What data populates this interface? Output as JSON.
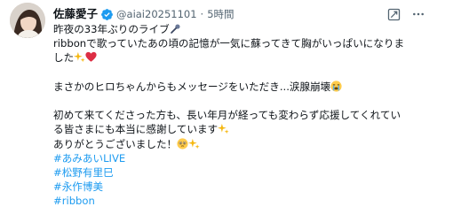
{
  "tweet": {
    "display_name": "佐藤愛子",
    "handle": "@aiai20251101",
    "separator": "·",
    "time": "5時間",
    "lines": [
      "昨夜の33年ぶりのライブ",
      "ribbonで歌っていたあの頃の記憶が一気に蘇ってきて胸がいっぱいになりま",
      "した",
      "",
      "まさかのヒロちゃんからもメッセージをいただき...涙腺崩壊",
      "",
      "初めて来てくださった方も、長い年月が経っても変わらず応援してくれてい",
      "る皆さまにも本当に感謝しています",
      "ありがとうございました！"
    ],
    "hashtags": [
      "#あみあいLIVE",
      "#松野有里巳",
      "#永作博美",
      "#ribbon"
    ],
    "icons": {
      "verified": "verified-badge-icon",
      "grok": "grok-icon",
      "more": "more-options-icon",
      "microphone": "microphone-emoji",
      "sparkles": "sparkles-emoji",
      "heart": "red-heart-emoji",
      "crying": "loudly-crying-face-emoji",
      "teary": "face-holding-back-tears-emoji"
    },
    "colors": {
      "text": "#0f1419",
      "secondary": "#536471",
      "link": "#1d9bf0",
      "verified": "#1d9bf0"
    }
  }
}
